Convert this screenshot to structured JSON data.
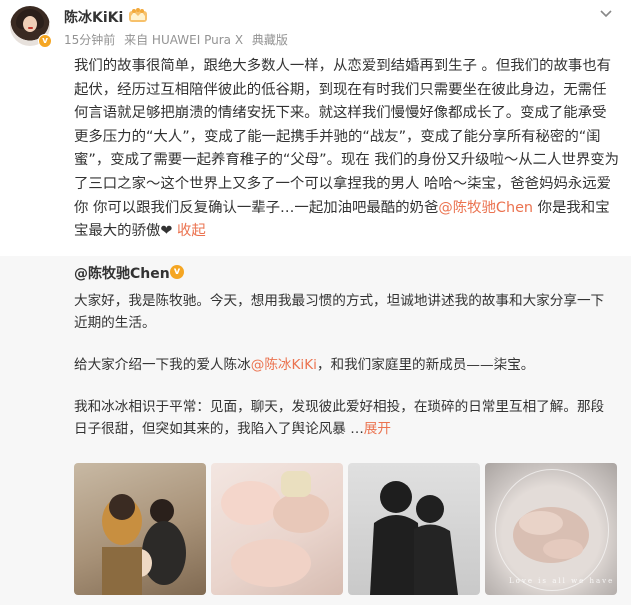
{
  "post": {
    "username": "陈冰KiKi",
    "time": "15分钟前",
    "source": "来自 HUAWEI Pura X",
    "collection": "典藏版",
    "content_parts": {
      "main": "我们的故事很简单，跟绝大多数人一样，从恋爱到结婚再到生子 。但我们的故事也有起伏，经历过互相陪伴彼此的低谷期，到现在有时我们只需要坐在彼此身边，无需任何言语就足够把崩溃的情绪安抚下来。就这样我们慢慢好像都成长了。变成了能承受更多压力的“大人”，变成了能一起携手并驰的“战友”，变成了能分享所有秘密的“闺蜜”，变成了需要一起养育稚子的“父母”。现在 我们的身份又升级啦～从二人世界变为了三口之家～这个世界上又多了一个可以拿捏我的男人 哈哈～柒宝，爸爸妈妈永远爱你 你可以跟我们反复确认一辈子…一起加油吧最酷的奶爸",
      "mention": "@陈牧驰Chen",
      "tail": " 你是我和宝宝最大的骄傲",
      "heart": "❤",
      "collapse_label": "收起"
    }
  },
  "repost": {
    "author": "@陈牧驰Chen",
    "para1": "大家好，我是陈牧驰。今天，想用我最习惯的方式，坦诚地讲述我的故事和大家分享一下近期的生活。",
    "para2_pre": "给大家介绍一下我的爱人陈冰",
    "para2_mention": "@陈冰KiKi",
    "para2_post": "，和我们家庭里的新成员——柒宝。",
    "para3": "我和冰冰相识于平常：见面，聊天，发现彼此爱好相投，在琐碎的日常里互相了解。那段日子很甜，但突如其来的，我陷入了舆论风暴 …",
    "expand_label": "展开"
  },
  "images": {
    "caption4": "Love is all we have"
  },
  "colors": {
    "link": "#eb7350",
    "badge": "#f5a623",
    "meta": "#939393"
  },
  "icons": [
    "crown-icon",
    "chevron-down-icon",
    "verified-icon",
    "heart-icon"
  ]
}
